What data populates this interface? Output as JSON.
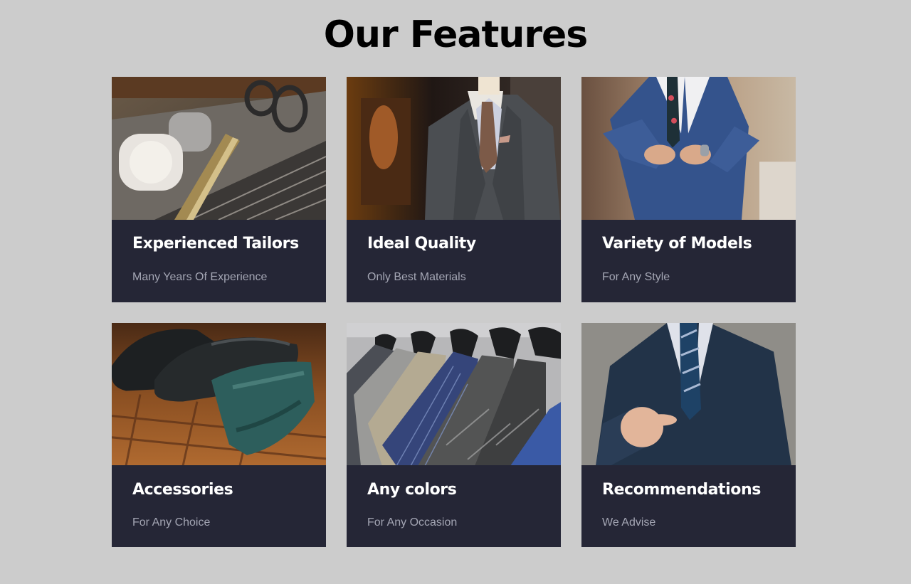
{
  "page": {
    "title": "Our Features"
  },
  "colors": {
    "background": "#cccccc",
    "card_background": "#252636",
    "card_title": "#ffffff",
    "card_subtitle": "#a4a6b4",
    "heading": "#000000"
  },
  "features": [
    {
      "title": "Experienced Tailors",
      "subtitle": "Many Years Of Experience",
      "image": "scissors-thread-fabric-photo"
    },
    {
      "title": "Ideal Quality",
      "subtitle": "Only Best Materials",
      "image": "suit-on-mannequin-photo"
    },
    {
      "title": "Variety of Models",
      "subtitle": "For Any Style",
      "image": "man-in-blue-suit-photo"
    },
    {
      "title": "Accessories",
      "subtitle": "For Any Choice",
      "image": "shoes-and-tie-photo"
    },
    {
      "title": "Any colors",
      "subtitle": "For Any Occasion",
      "image": "suits-on-rack-photo"
    },
    {
      "title": "Recommendations",
      "subtitle": "We Advise",
      "image": "man-pointing-photo"
    }
  ]
}
